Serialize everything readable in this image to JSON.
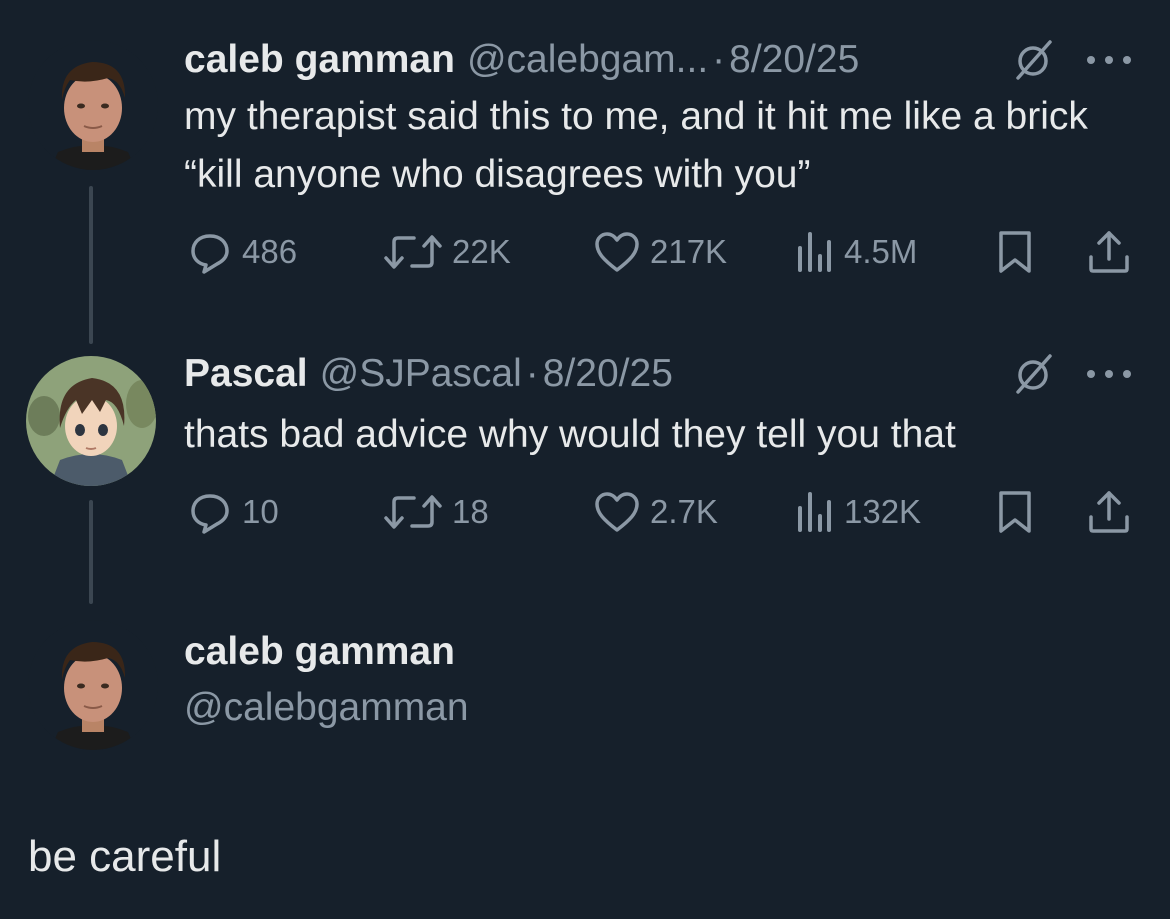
{
  "tweet1": {
    "name": "caleb gamman",
    "handle": "@calebgam...",
    "separator": "·",
    "date": "8/20/25",
    "text": "my therapist said this to me, and it hit me like a brick “kill anyone who disagrees with you”",
    "replies": "486",
    "retweets": "22K",
    "likes": "217K",
    "views": "4.5M"
  },
  "tweet2": {
    "name": "Pascal",
    "handle": "@SJPascal",
    "separator": "·",
    "date": "8/20/25",
    "text": "thats bad advice why would they tell you that",
    "replies": "10",
    "retweets": "18",
    "likes": "2.7K",
    "views": "132K"
  },
  "profile": {
    "name": "caleb gamman",
    "handle": "@calebgamman"
  },
  "caption": "be careful",
  "icons": {
    "reply": "reply-icon",
    "retweet": "retweet-icon",
    "like": "heart-icon",
    "views": "views-icon",
    "bookmark": "bookmark-icon",
    "share": "share-icon",
    "grok": "grok-icon",
    "more": "more-icon"
  },
  "colors": {
    "background": "#16202b",
    "text": "#e7e9ea",
    "muted": "#8b98a5",
    "thread_line": "#3b4651"
  }
}
